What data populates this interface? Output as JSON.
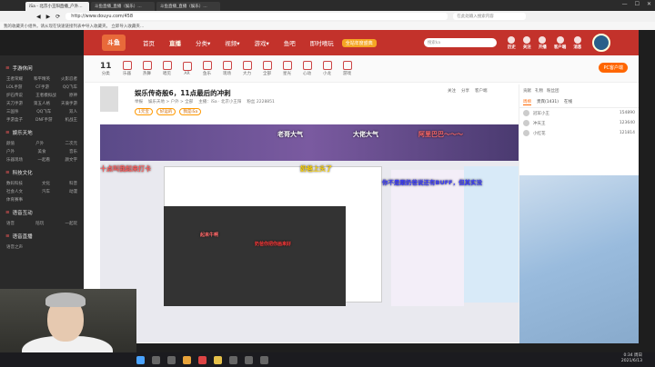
{
  "browser": {
    "tabs": [
      {
        "label": "iSa - 北京小王阳直播_户外…"
      },
      {
        "label": "斗鱼直播_直播（娱乐）…"
      },
      {
        "label": "斗鱼直播_直播（娱乐）…"
      }
    ],
    "url": "http://www.douyu.com/458",
    "search_placeholder": "在此处输入搜索内容"
  },
  "bookmarks": {
    "text": "我的收藏夹小组件。请从现在快速链接列表中导入收藏夹。 立即导入收藏夹…"
  },
  "header": {
    "brand": "斗鱼",
    "nav": [
      "首页",
      "直播",
      "分类▾",
      "视频▾",
      "游戏▾",
      "鱼吧",
      "即时嘻玩"
    ],
    "promo": "全站年度盛典",
    "search_placeholder": "搜索ka",
    "icons": [
      {
        "label": "历史",
        "name": "history-icon"
      },
      {
        "label": "关注",
        "name": "follow-icon"
      },
      {
        "label": "开播",
        "name": "live-icon"
      },
      {
        "label": "客户端",
        "name": "client-icon"
      },
      {
        "label": "消息",
        "name": "message-icon"
      }
    ]
  },
  "sidebar": {
    "sections": [
      {
        "title": "手游休闲",
        "rows": [
          [
            "王者荣耀",
            "和平精英",
            "火影忍者"
          ],
          [
            "LOL手游",
            "CF手游",
            "QQ飞车"
          ],
          [
            "炉石传说",
            "王者模拟战",
            "原神"
          ],
          [
            "天刀手游",
            "第五人格",
            "天谕手游"
          ],
          [
            "三国杀",
            "QQ飞车",
            "双人"
          ],
          [
            "手游盒子",
            "DNF手游",
            "机战王"
          ]
        ]
      },
      {
        "title": "娱乐天地",
        "rows": [
          [
            "颜值",
            "户外",
            "二次元"
          ],
          [
            "户外",
            "美食",
            "音乐"
          ],
          [
            "乐器现场",
            "一起看",
            "颜文字"
          ]
        ]
      },
      {
        "title": "科技文化",
        "rows": [
          [
            "数码科技",
            "文化",
            "科普"
          ],
          [
            "社会人文",
            "汽车",
            "动漫"
          ],
          [
            "体育赛事",
            "",
            ""
          ]
        ]
      },
      {
        "title": "语音互动",
        "rows": [
          [
            "语音",
            "陪玩",
            "一起玩"
          ]
        ]
      },
      {
        "title": "语音直播",
        "rows": [
          [
            "语音之声",
            "",
            ""
          ]
        ]
      }
    ]
  },
  "categories": {
    "count": "11",
    "count_label": "分类",
    "items": [
      "乐器",
      "热舞",
      "唱见",
      "AR",
      "鱼乐",
      "现场",
      "大力",
      "全部",
      "星光",
      "心动",
      "小龙",
      "游戏"
    ],
    "pc_button": "PC客户端"
  },
  "room": {
    "title": "娱乐传奇般6，11点最后的冲刺",
    "meta": [
      "举报",
      "娱乐天地 > 户外 > 全部",
      "主播：iSa · 北京小王阳",
      "粉丝 2228851"
    ],
    "tags": [
      "1元宝",
      "好运的",
      "我是iSa"
    ],
    "right_items": [
      "关注",
      "分享",
      "客户端"
    ]
  },
  "danmu": [
    {
      "text": "老哥大气",
      "color": "#ffffff"
    },
    {
      "text": "大佬大气",
      "color": "#ffffff"
    },
    {
      "text": "阿里巴巴～～～",
      "color": "#ff6a6a"
    },
    {
      "text": "十点叫我起来打卡",
      "color": "#ff5a5a"
    },
    {
      "text": "奶爸上头了",
      "color": "#ffd400"
    },
    {
      "text": "你不是跟奶爸说还有BUFF，但其实没",
      "color": "#3a3aff"
    },
    {
      "text": "起来牛啊",
      "color": "#ff6a6a"
    },
    {
      "text": "奶爸你把你画来好",
      "color": "#ff3a3a"
    }
  ],
  "chat": {
    "header": [
      "贡献",
      "礼物",
      "粉丝团"
    ],
    "tabs": [
      "周榜",
      "贵宾(1431)",
      "在线"
    ],
    "ranks": [
      {
        "name": "冠军小王",
        "score": "154890"
      },
      {
        "name": "冲天王",
        "score": "123640"
      },
      {
        "name": "小红花",
        "score": "121814"
      }
    ]
  },
  "taskbar": {
    "time": "0:34 周日",
    "date": "2021/6/13"
  }
}
